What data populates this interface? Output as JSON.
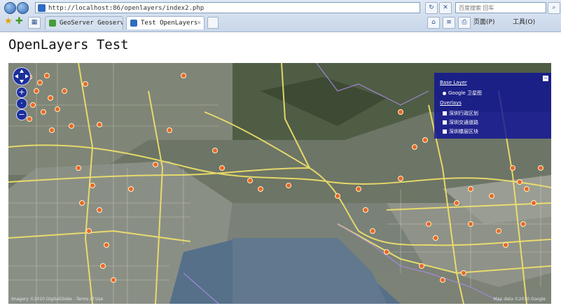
{
  "browser": {
    "address": "http://localhost:86/openlayers/index2.php",
    "search_placeholder": "百度搜索 回车",
    "tabs": [
      {
        "label": "GeoServer Geoserver",
        "active": false
      },
      {
        "label": "Test OpenLayers",
        "active": true
      }
    ],
    "commands": {
      "page": "页面(P)",
      "tools": "工具(O)"
    }
  },
  "page": {
    "title": "OpenLayers Test"
  },
  "map": {
    "layer_switcher": {
      "base_heading": "Base Layer",
      "base_layers": [
        {
          "label": "Google 卫星图",
          "selected": true
        }
      ],
      "overlay_heading": "Overlays",
      "overlays": [
        {
          "label": "深圳行政区划",
          "checked": true
        },
        {
          "label": "深圳交通道路",
          "checked": true
        },
        {
          "label": "深圳楼层区块",
          "checked": true
        }
      ]
    },
    "attribution_left": "Imagery ©2010 DigitalGlobe - Terms of Use",
    "attribution_right": "Map data ©2010 Google",
    "colors": {
      "roads": "#f2e36a",
      "pois": "#e8672a",
      "boundary": "#a98ae0",
      "switcher": "#10128f"
    }
  }
}
